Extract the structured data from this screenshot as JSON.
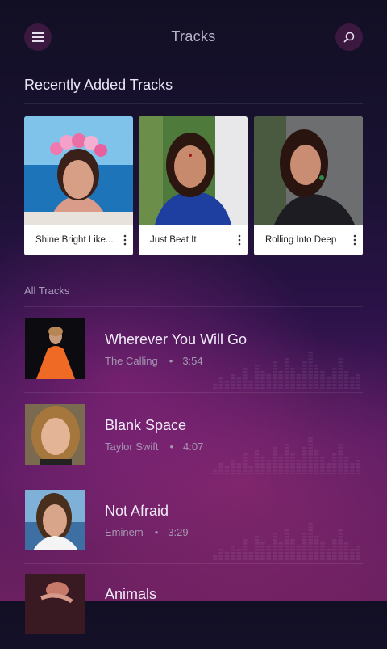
{
  "header": {
    "title": "Tracks"
  },
  "recently_added": {
    "title": "Recently Added Tracks",
    "cards": [
      {
        "title": "Shine Bright Like..."
      },
      {
        "title": "Just Beat It"
      },
      {
        "title": "Rolling Into Deep"
      }
    ]
  },
  "all_tracks": {
    "label": "All Tracks",
    "tracks": [
      {
        "title": "Wherever You Will Go",
        "artist": "The Calling",
        "duration": "3:54"
      },
      {
        "title": "Blank Space",
        "artist": "Taylor Swift",
        "duration": "4:07"
      },
      {
        "title": "Not Afraid",
        "artist": "Eminem",
        "duration": "3:29"
      },
      {
        "title": "Animals",
        "artist": "",
        "duration": ""
      }
    ]
  },
  "icons": {
    "menu": "menu-icon",
    "search": "search-icon",
    "more": "more-vertical-icon"
  },
  "colors": {
    "accent_button": "#3a1840",
    "background_top": "#120f24",
    "background_bottom": "#6b2060"
  }
}
